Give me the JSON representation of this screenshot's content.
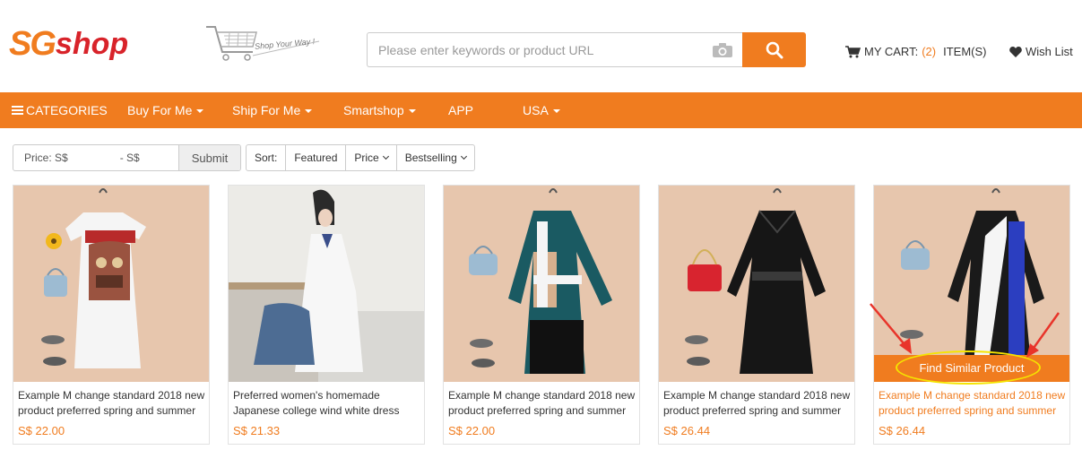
{
  "header": {
    "logo_mark": "SG",
    "logo_word": "shop",
    "tagline": "Shop Your Way !",
    "search": {
      "placeholder": "Please enter keywords or product URL"
    },
    "cart": {
      "label": "MY CART:",
      "count": "(2)",
      "suffix": "ITEM(S)"
    },
    "wishlist": "Wish List"
  },
  "nav": {
    "categories": "CATEGORIES",
    "items": [
      {
        "label": "Buy For Me"
      },
      {
        "label": "Ship For Me"
      },
      {
        "label": "Smartshop"
      },
      {
        "label": "APP"
      },
      {
        "label": "USA"
      }
    ]
  },
  "filters": {
    "price_from": "Price: S$",
    "price_to": "- S$",
    "submit": "Submit",
    "sort_label": "Sort:",
    "sort_options": [
      "Featured",
      "Price",
      "Bestselling"
    ]
  },
  "products": [
    {
      "title": "Example M change standard 2018 new product preferred spring and summer",
      "price": "S$ 22.00"
    },
    {
      "title": "Preferred women's homemade Japanese college wind white dress",
      "price": "S$ 21.33"
    },
    {
      "title": "Example M change standard 2018 new product preferred spring and summer",
      "price": "S$ 22.00"
    },
    {
      "title": "Example M change standard 2018 new product preferred spring and summer",
      "price": "S$ 26.44"
    },
    {
      "title": "Example M change standard 2018 new product preferred spring and summer",
      "price": "S$ 26.44"
    }
  ],
  "find_similar": "Find Similar Product",
  "colors": {
    "accent": "#f07c1f",
    "logo_red": "#d8232a",
    "image_bg": "#e7c6ad",
    "highlight": "#f5e400",
    "annotation_arrow": "#e8342a"
  },
  "icons": [
    "cart-icon",
    "camera-icon",
    "search-icon",
    "shopping-cart-icon",
    "heart-icon",
    "menu-icon"
  ]
}
